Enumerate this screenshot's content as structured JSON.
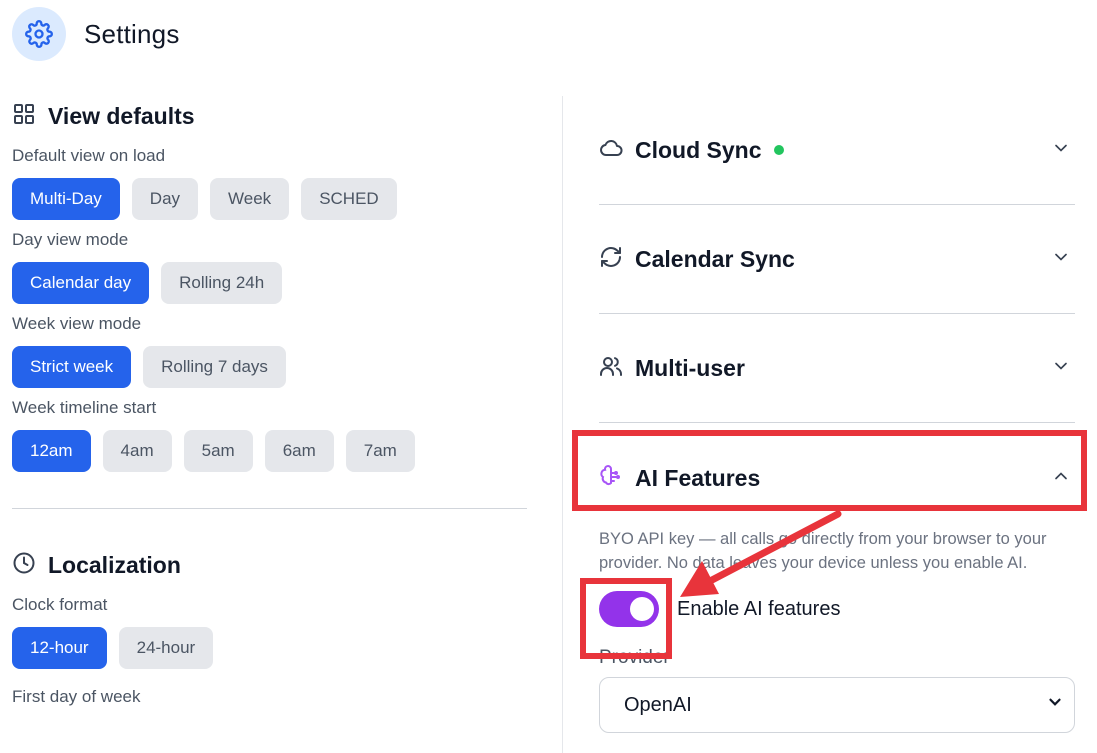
{
  "header": {
    "title": "Settings",
    "icon": "gear-icon"
  },
  "view_defaults": {
    "title": "View defaults",
    "icon": "grid-icon",
    "groups": [
      {
        "label": "Default view on load",
        "options": [
          "Multi-Day",
          "Day",
          "Week",
          "SCHED"
        ],
        "selected": "Multi-Day"
      },
      {
        "label": "Day view mode",
        "options": [
          "Calendar day",
          "Rolling 24h"
        ],
        "selected": "Calendar day"
      },
      {
        "label": "Week view mode",
        "options": [
          "Strict week",
          "Rolling 7 days"
        ],
        "selected": "Strict week"
      },
      {
        "label": "Week timeline start",
        "options": [
          "12am",
          "4am",
          "5am",
          "6am",
          "7am"
        ],
        "selected": "12am"
      }
    ]
  },
  "localization": {
    "title": "Localization",
    "icon": "clock-icon",
    "groups": [
      {
        "label": "Clock format",
        "options": [
          "12-hour",
          "24-hour"
        ],
        "selected": "12-hour"
      }
    ],
    "next_label": "First day of week"
  },
  "accordions": [
    {
      "name": "Cloud Sync",
      "icon": "cloud-icon",
      "status_dot": true,
      "expanded": false
    },
    {
      "name": "Calendar Sync",
      "icon": "refresh-icon",
      "status_dot": false,
      "expanded": false
    },
    {
      "name": "Multi-user",
      "icon": "users-icon",
      "status_dot": false,
      "expanded": false
    }
  ],
  "ai": {
    "name": "AI Features",
    "icon": "brain-icon",
    "expanded": true,
    "description": "BYO API key — all calls go directly from your browser to your provider. No data leaves your device unless you enable AI.",
    "toggle_label": "Enable AI features",
    "toggle_on": true,
    "provider_label": "Provider",
    "provider_value": "OpenAI"
  },
  "colors": {
    "accent": "#2563eb",
    "toggle": "#9333ea",
    "highlight": "#e8343b",
    "status_green": "#22c55e"
  }
}
